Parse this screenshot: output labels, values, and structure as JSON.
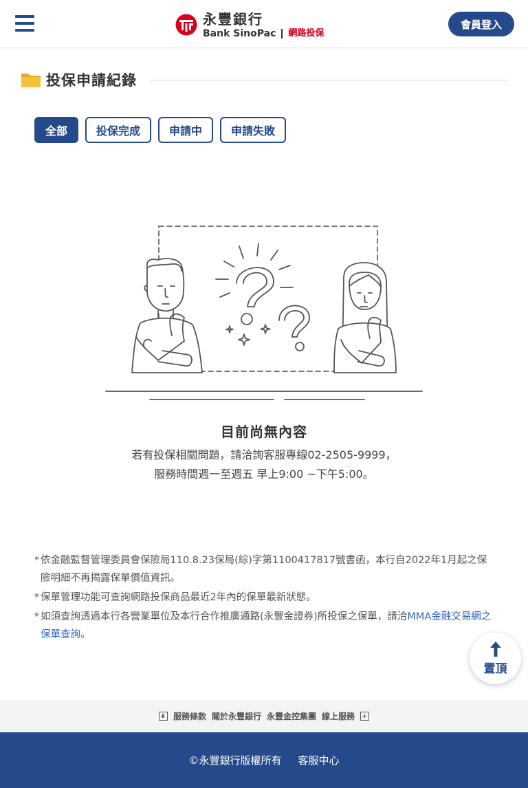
{
  "header": {
    "logo_cn": "永豐銀行",
    "logo_en": "Bank SinoPac",
    "logo_sub": "網路投保",
    "login_label": "會員登入"
  },
  "section": {
    "title": "投保申請紀錄"
  },
  "tabs": [
    {
      "label": "全部",
      "active": true
    },
    {
      "label": "投保完成",
      "active": false
    },
    {
      "label": "申請中",
      "active": false
    },
    {
      "label": "申請失敗",
      "active": false
    }
  ],
  "empty": {
    "title": "目前尚無內容",
    "line1": "若有投保相關問題，請洽詢客服專線02-2505-9999，",
    "line2": "服務時間週一至週五 早上9:00 ~下午5:00。"
  },
  "notes": [
    {
      "star": "*",
      "text": "依金融監督管理委員會保險局110.8.23保局(綜)字第1100417817號書函，本行自2022年1月起之保險明細不再揭露保單價值資訊。"
    },
    {
      "star": "*",
      "text": "保單管理功能可查詢網路投保商品最近2年內的保單最新狀態。"
    },
    {
      "star": "*",
      "text": "如須查詢透過本行各營業單位及本行合作推廣通路(永豐金證券)所投保之保單，請洽",
      "link": "MMA金融交易網之保單查詢",
      "after": "。"
    }
  ],
  "top_button": {
    "label": "置頂"
  },
  "footer_links": [
    "服務條款",
    "關於永豐銀行",
    "永豐金控集團",
    "線上服務"
  ],
  "bottom": {
    "copyright": "©永豐銀行版權所有",
    "service": "客服中心"
  },
  "colors": {
    "brand_blue": "#254a8c",
    "logo_red": "#d7001b",
    "link_blue": "#2d66c5",
    "folder_yellow": "#f5c13a"
  }
}
